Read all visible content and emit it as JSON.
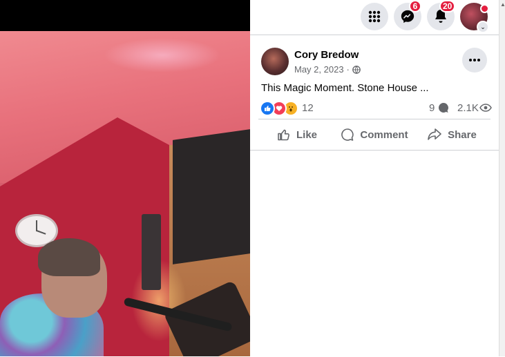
{
  "topbar": {
    "menu_icon": "grid-icon",
    "messenger": {
      "icon": "messenger-icon",
      "badge": "6"
    },
    "notifications": {
      "icon": "bell-icon",
      "badge": "20"
    },
    "account_chevron": "chevron-down-icon"
  },
  "post": {
    "author": "Cory Bredow",
    "date": "May 2, 2023",
    "separator": "·",
    "privacy_icon": "globe-icon",
    "text": "This Magic Moment. Stone House ...",
    "reactions": {
      "icons": [
        "like-icon",
        "love-icon",
        "wow-icon"
      ],
      "count": "12"
    },
    "comments_count": "9",
    "views_count": "2.1K",
    "actions": {
      "like": "Like",
      "comment": "Comment",
      "share": "Share"
    }
  },
  "colors": {
    "brand_blue": "#1877f2",
    "badge_red": "#e41e3f",
    "love_red": "#f33e58",
    "wow_yellow": "#f7b125",
    "secondary_text": "#65676b"
  }
}
